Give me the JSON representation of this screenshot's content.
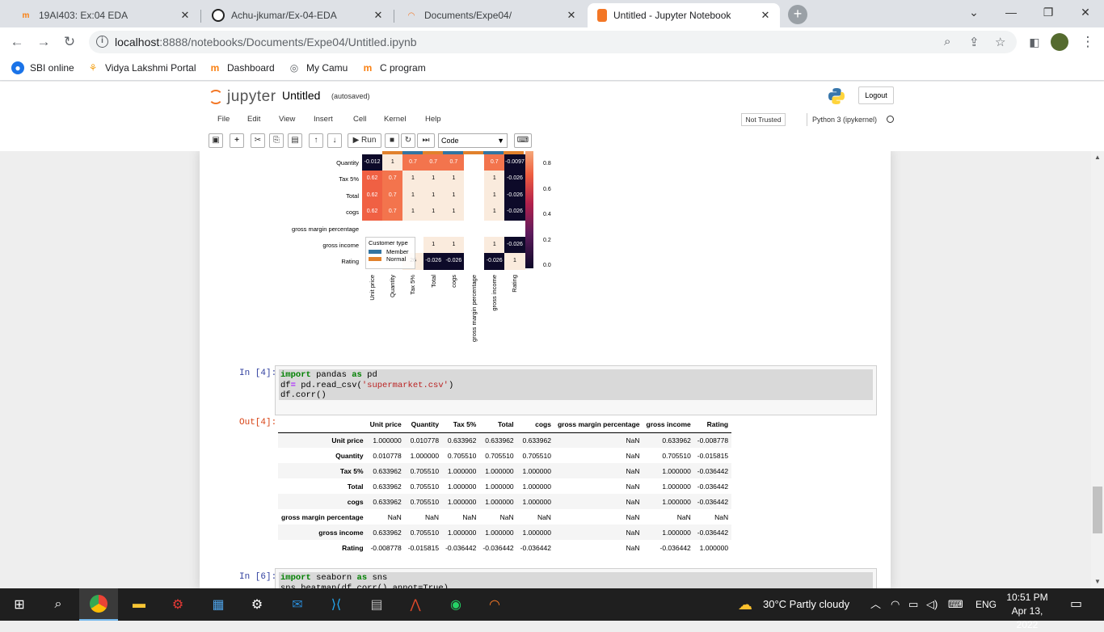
{
  "browser": {
    "tabs": [
      {
        "title": "19AI403: Ex:04 EDA",
        "icon": "moodle-icon"
      },
      {
        "title": "Achu-jkumar/Ex-04-EDA",
        "icon": "github-icon"
      },
      {
        "title": "Documents/Expe04/",
        "icon": "jupyter-icon"
      },
      {
        "title": "Untitled - Jupyter Notebook",
        "icon": "notebook-icon"
      }
    ],
    "url_host": "localhost",
    "url_rest": ":8888/notebooks/Documents/Expe04/Untitled.ipynb",
    "bookmarks": [
      {
        "label": "SBI online",
        "icon": "sbi-icon"
      },
      {
        "label": "Vidya Lakshmi Portal",
        "icon": "portal-icon"
      },
      {
        "label": "Dashboard",
        "icon": "moodle-icon"
      },
      {
        "label": "My Camu",
        "icon": "camu-icon"
      },
      {
        "label": "C program",
        "icon": "moodle-icon"
      }
    ]
  },
  "jupyter": {
    "brand": "jupyter",
    "notebook_name": "Untitled",
    "autosave": "(autosaved)",
    "logout": "Logout",
    "menu": [
      "File",
      "Edit",
      "View",
      "Insert",
      "Cell",
      "Kernel",
      "Help"
    ],
    "trust": "Not Trusted",
    "kernel": "Python 3 (ipykernel)",
    "toolbar": {
      "run": "Run",
      "cell_type": "Code"
    }
  },
  "heatmap": {
    "row_labels": [
      "Quantity",
      "Tax 5%",
      "Total",
      "cogs",
      "gross margin percentage",
      "gross income",
      "Rating"
    ],
    "col_labels": [
      "Unit price",
      "Quantity",
      "Tax 5%",
      "Total",
      "cogs",
      "gross margin percentage",
      "gross income",
      "Rating"
    ],
    "colorbar_ticks": [
      "0.8",
      "0.6",
      "0.4",
      "0.2",
      "0.0"
    ],
    "cells": [
      [
        "-0.012",
        "1",
        "0.7",
        "0.7",
        "0.7",
        "",
        "0.7",
        "-0.0097"
      ],
      [
        "0.62",
        "0.7",
        "1",
        "1",
        "1",
        "",
        "1",
        "-0.026"
      ],
      [
        "0.62",
        "0.7",
        "1",
        "1",
        "1",
        "",
        "1",
        "-0.026"
      ],
      [
        "0.62",
        "0.7",
        "1",
        "1",
        "1",
        "",
        "1",
        "-0.026"
      ],
      [
        "",
        "",
        "",
        "",
        "",
        "",
        "",
        ""
      ],
      [
        "",
        "",
        "",
        "1",
        "1",
        "",
        "1",
        "-0.026"
      ],
      [
        "",
        "",
        "26",
        "-0.026",
        "-0.026",
        "",
        "-0.026",
        "1"
      ]
    ],
    "legend": {
      "title": "Customer type",
      "items": [
        "Member",
        "Normal"
      ]
    },
    "colors": {
      "high": "#faebdd",
      "mid": "#f06043",
      "mid2": "#f3744d",
      "low": "#0d0a29",
      "member": "#3274a1",
      "normal": "#e1812c"
    }
  },
  "cell4": {
    "in_prompt": "In [4]:",
    "out_prompt": "Out[4]:",
    "code": [
      [
        {
          "t": "import",
          "c": "kw"
        },
        {
          "t": " pandas ",
          "c": ""
        },
        {
          "t": "as",
          "c": "kw"
        },
        {
          "t": " pd",
          "c": ""
        }
      ],
      [
        {
          "t": "df",
          "c": ""
        },
        {
          "t": "=",
          "c": "op"
        },
        {
          "t": " pd.read_csv(",
          "c": ""
        },
        {
          "t": "'supermarket.csv'",
          "c": "str"
        },
        {
          "t": ")",
          "c": ""
        }
      ],
      [
        {
          "t": "df.corr()",
          "c": ""
        }
      ]
    ]
  },
  "corr_table": {
    "columns": [
      "",
      "Unit price",
      "Quantity",
      "Tax 5%",
      "Total",
      "cogs",
      "gross margin percentage",
      "gross income",
      "Rating"
    ],
    "rows": [
      [
        "Unit price",
        "1.000000",
        "0.010778",
        "0.633962",
        "0.633962",
        "0.633962",
        "NaN",
        "0.633962",
        "-0.008778"
      ],
      [
        "Quantity",
        "0.010778",
        "1.000000",
        "0.705510",
        "0.705510",
        "0.705510",
        "NaN",
        "0.705510",
        "-0.015815"
      ],
      [
        "Tax 5%",
        "0.633962",
        "0.705510",
        "1.000000",
        "1.000000",
        "1.000000",
        "NaN",
        "1.000000",
        "-0.036442"
      ],
      [
        "Total",
        "0.633962",
        "0.705510",
        "1.000000",
        "1.000000",
        "1.000000",
        "NaN",
        "1.000000",
        "-0.036442"
      ],
      [
        "cogs",
        "0.633962",
        "0.705510",
        "1.000000",
        "1.000000",
        "1.000000",
        "NaN",
        "1.000000",
        "-0.036442"
      ],
      [
        "gross margin percentage",
        "NaN",
        "NaN",
        "NaN",
        "NaN",
        "NaN",
        "NaN",
        "NaN",
        "NaN"
      ],
      [
        "gross income",
        "0.633962",
        "0.705510",
        "1.000000",
        "1.000000",
        "1.000000",
        "NaN",
        "1.000000",
        "-0.036442"
      ],
      [
        "Rating",
        "-0.008778",
        "-0.015815",
        "-0.036442",
        "-0.036442",
        "-0.036442",
        "NaN",
        "-0.036442",
        "1.000000"
      ]
    ]
  },
  "cell6": {
    "in_prompt": "In [6]:",
    "code": [
      [
        {
          "t": "import",
          "c": "kw"
        },
        {
          "t": " seaborn ",
          "c": ""
        },
        {
          "t": "as",
          "c": "kw"
        },
        {
          "t": " sns",
          "c": ""
        }
      ],
      [
        {
          "t": "sns.heatmap(df.corr(),annot=True)",
          "c": ""
        }
      ]
    ]
  },
  "taskbar": {
    "apps": [
      "windows-start-icon",
      "search-icon",
      "chrome-icon",
      "file-explorer-icon",
      "app-icon",
      "control-panel-icon",
      "settings-icon",
      "mail-icon",
      "vscode-icon",
      "calculator-icon",
      "matlab-icon",
      "whatsapp-icon",
      "jupyter-icon"
    ],
    "weather": "30°C  Partly cloudy",
    "lang": "ENG",
    "time": "10:51 PM",
    "date": "Apr 13, 2022"
  }
}
